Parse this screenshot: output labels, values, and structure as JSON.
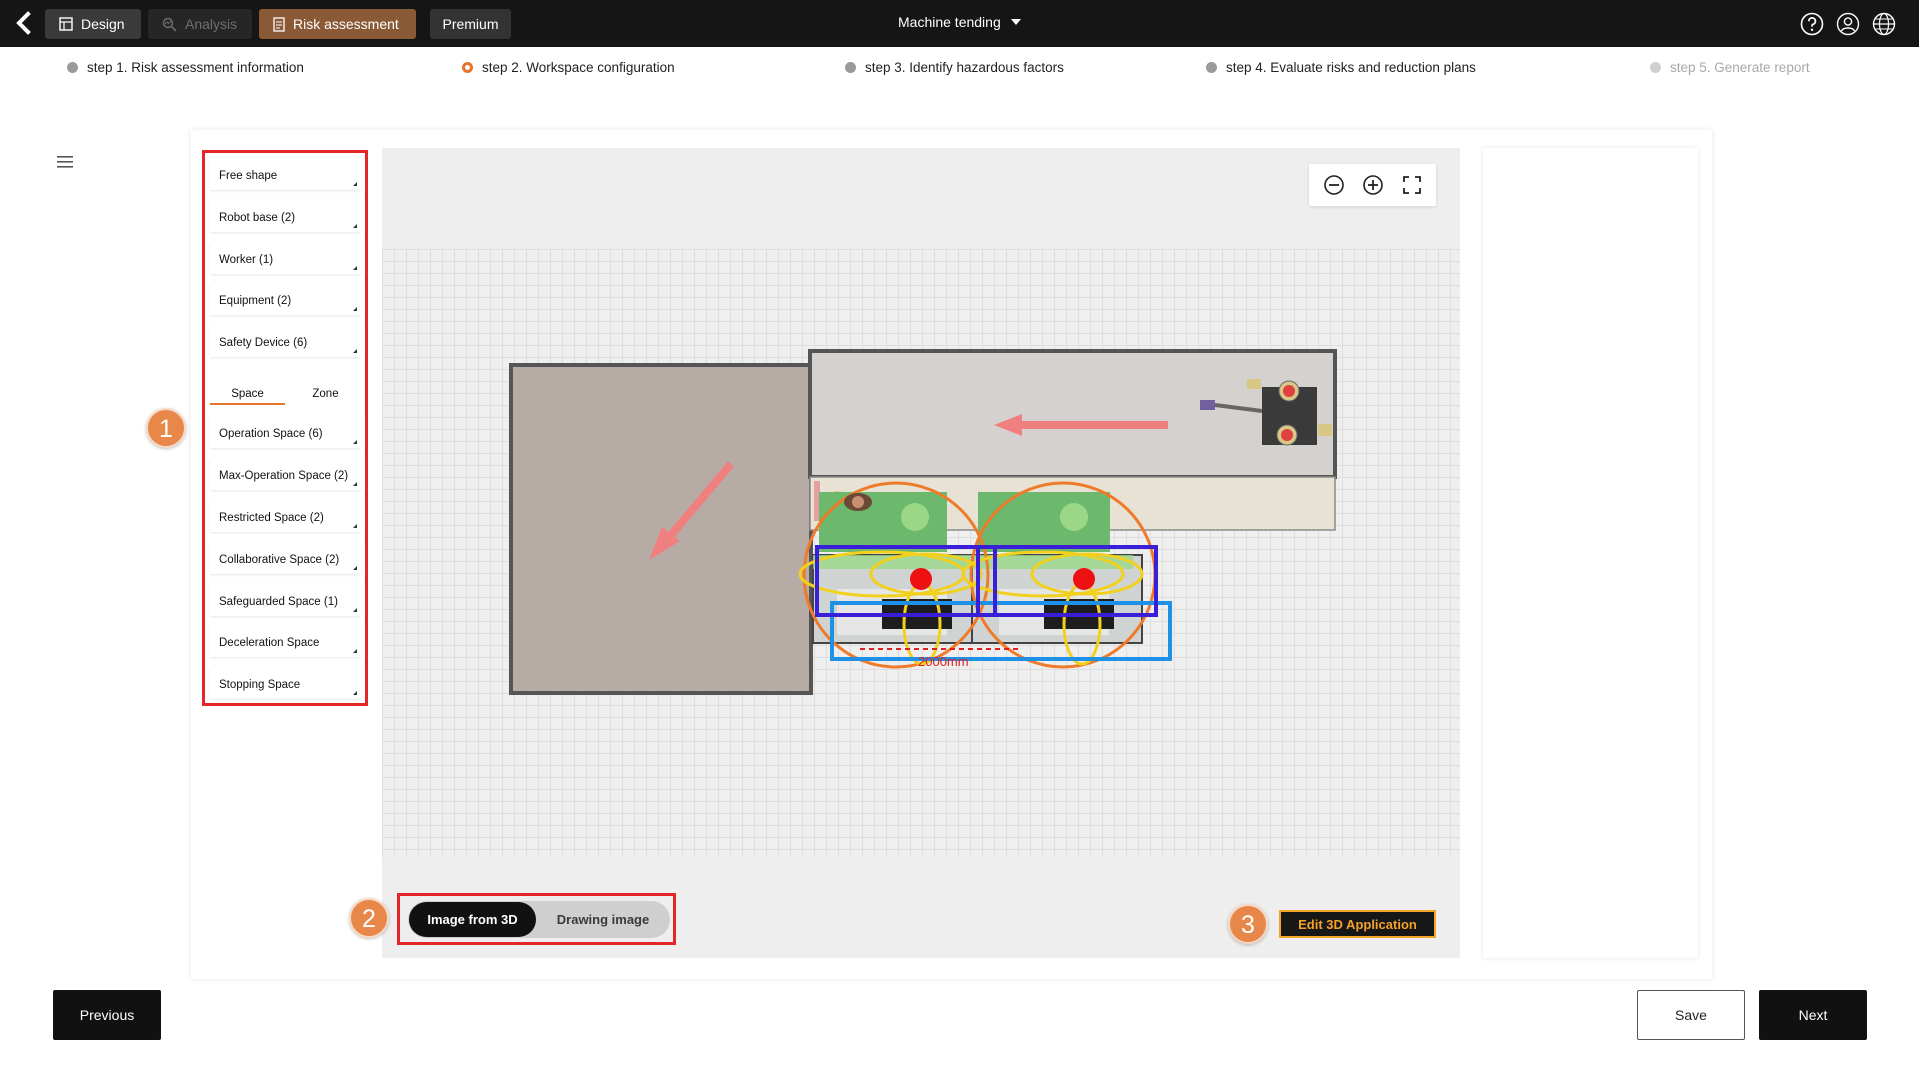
{
  "topbar": {
    "tabs": [
      {
        "label": "Design",
        "icon": "design-icon"
      },
      {
        "label": "Analysis",
        "icon": "analysis-icon"
      },
      {
        "label": "Risk assessment",
        "icon": "document-icon"
      },
      {
        "label": "Premium"
      }
    ],
    "project_name": "Machine tending",
    "icons": [
      "help-icon",
      "user-icon",
      "globe-icon"
    ]
  },
  "steps": [
    {
      "label": "step 1. Risk assessment information",
      "state": "done"
    },
    {
      "label": "step 2. Workspace configuration",
      "state": "active"
    },
    {
      "label": "step 3. Identify hazardous factors",
      "state": "todo"
    },
    {
      "label": "step 4. Evaluate risks and reduction plans",
      "state": "todo"
    },
    {
      "label": "step 5. Generate report",
      "state": "disabled"
    }
  ],
  "palette": {
    "items": [
      "Free shape",
      "Robot base (2)",
      "Worker (1)",
      "Equipment (2)",
      "Safety Device (6)"
    ],
    "tabs": [
      "Space",
      "Zone"
    ],
    "active_tab": "Space",
    "space_items": [
      "Operation Space (6)",
      "Max-Operation Space (2)",
      "Restricted Space (2)",
      "Collaborative Space (2)",
      "Safeguarded Space (1)",
      "Deceleration Space",
      "Stopping Space"
    ]
  },
  "badges": [
    "1",
    "2",
    "3"
  ],
  "canvas": {
    "zoom_controls": [
      "zoom-out-icon",
      "zoom-in-icon",
      "fullscreen-icon"
    ],
    "dimension_label": "2000mm"
  },
  "image_toggle": {
    "options": [
      "Image from 3D",
      "Drawing image"
    ],
    "selected": "Image from 3D"
  },
  "edit_button": "Edit 3D Application",
  "footer": {
    "previous": "Previous",
    "save": "Save",
    "next": "Next"
  },
  "colors": {
    "accent": "#e8742c",
    "highlight_border": "#e4262a",
    "risk_tab": "#8a5a36",
    "edit_text": "#f4a12a"
  }
}
